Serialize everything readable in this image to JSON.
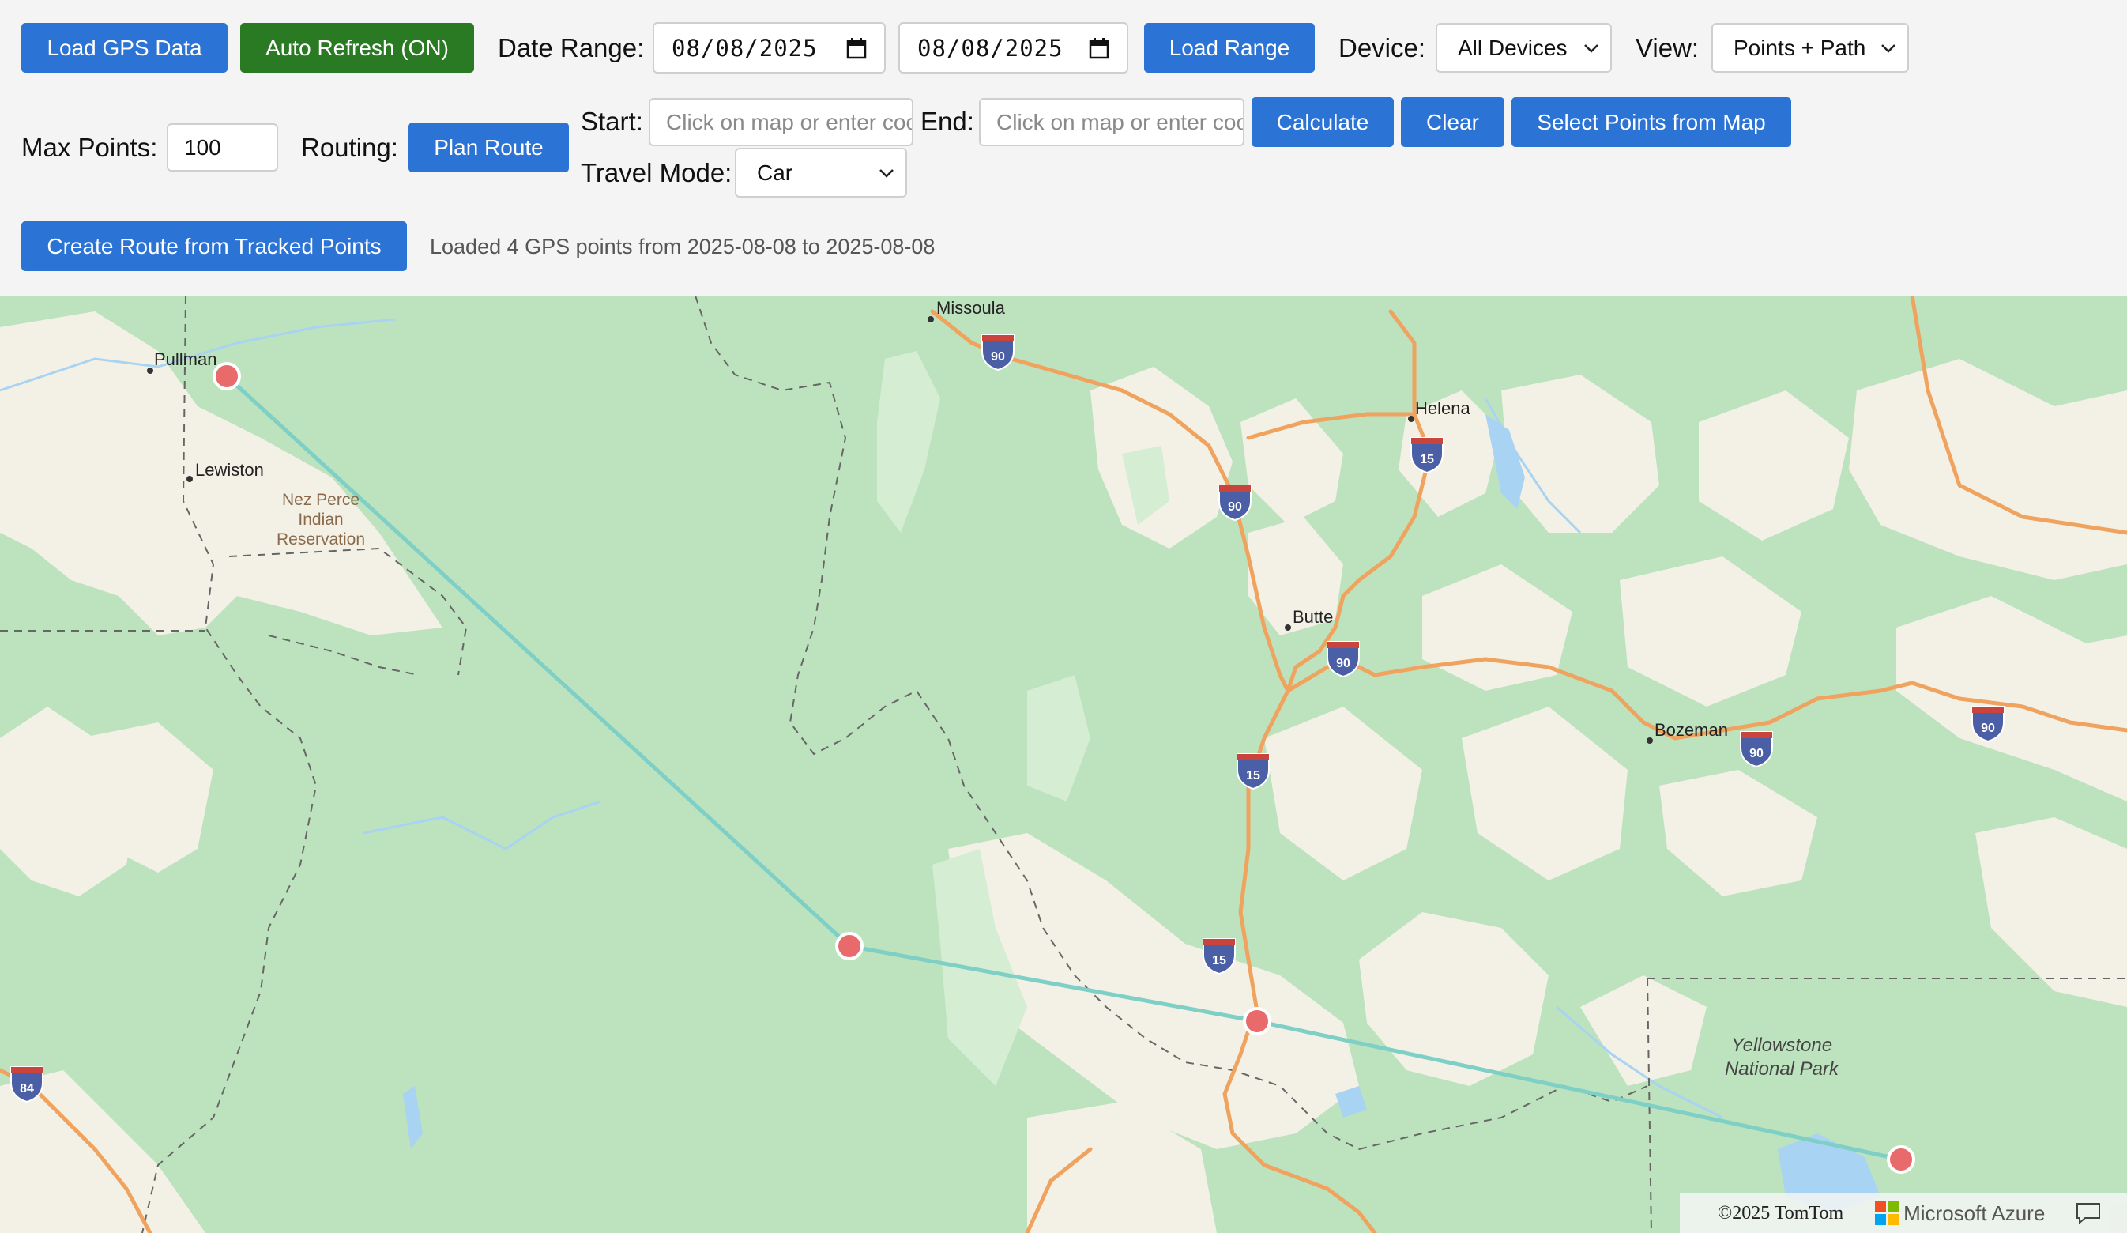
{
  "toolbar": {
    "load_gps_label": "Load GPS Data",
    "auto_refresh_label": "Auto Refresh (ON)",
    "date_range_label": "Date Range:",
    "date_start": "08/08/2025",
    "date_end": "08/08/2025",
    "load_range_label": "Load Range",
    "device_label": "Device:",
    "device_selected": "All Devices",
    "view_label": "View:",
    "view_selected": "Points + Path",
    "max_points_label": "Max Points:",
    "max_points_value": "100",
    "routing_label": "Routing:",
    "plan_route_label": "Plan Route",
    "start_label": "Start:",
    "start_placeholder": "Click on map or enter coordinates",
    "end_label": "End:",
    "end_placeholder": "Click on map or enter coordinates",
    "calculate_label": "Calculate",
    "clear_label": "Clear",
    "select_points_label": "Select Points from Map",
    "travel_mode_label": "Travel Mode:",
    "travel_mode_selected": "Car",
    "create_route_label": "Create Route from Tracked Points",
    "status_text": "Loaded 4 GPS points from 2025-08-08 to 2025-08-08"
  },
  "map": {
    "cities": [
      {
        "name": "Missoula"
      },
      {
        "name": "Pullman"
      },
      {
        "name": "Lewiston"
      },
      {
        "name": "Helena"
      },
      {
        "name": "Butte"
      },
      {
        "name": "Bozeman"
      }
    ],
    "areas": {
      "nez_perce_1": "Nez Perce",
      "nez_perce_2": "Indian",
      "nez_perce_3": "Reservation",
      "yellowstone_1": "Yellowstone",
      "yellowstone_2": "National Park"
    },
    "shields": [
      "90",
      "90",
      "90",
      "90",
      "90",
      "15",
      "15",
      "15",
      "84"
    ],
    "path_color": "#7ecfc6",
    "point_color": "#e86a6a",
    "attribution_text": "©2025 TomTom",
    "provider_text": "Microsoft Azure"
  }
}
